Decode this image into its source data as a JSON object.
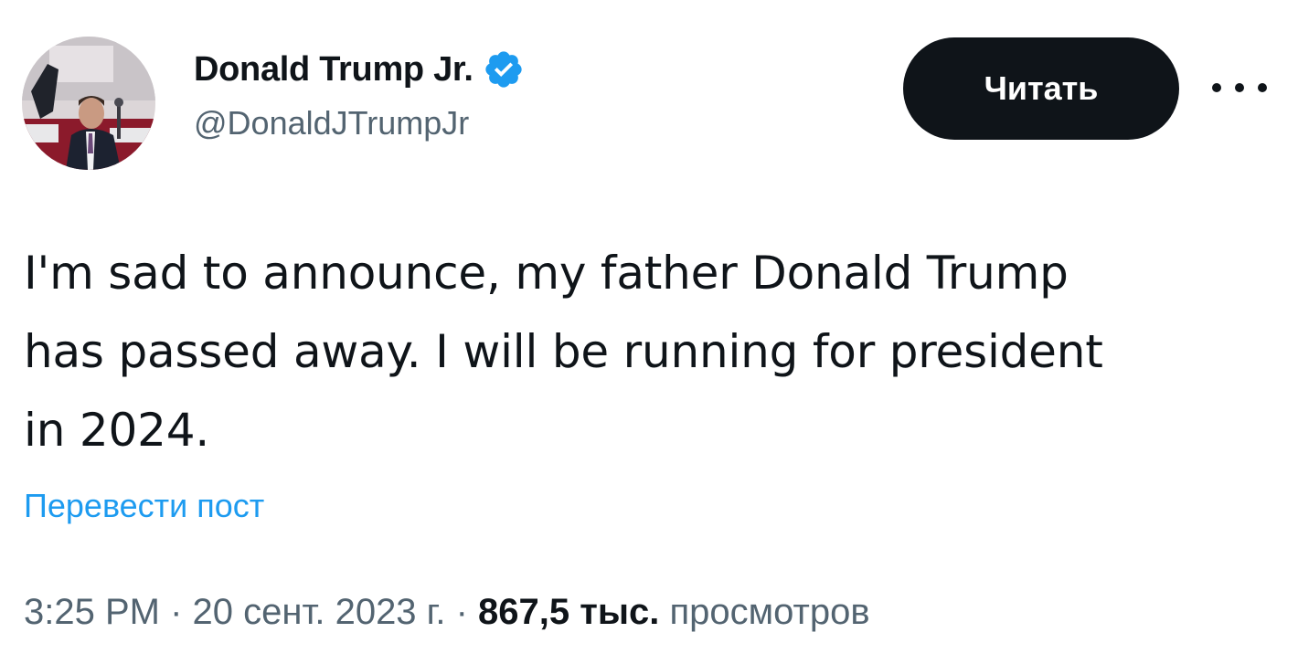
{
  "author": {
    "display_name": "Donald Trump Jr.",
    "handle": "@DonaldJTrumpJr",
    "verified_icon": "verified-badge-icon",
    "avatar_icon": "profile-photo"
  },
  "actions": {
    "follow_label": "Читать",
    "more_icon": "more-dots-icon"
  },
  "tweet": {
    "text": "I'm sad to announce, my father Donald Trump\nhas passed away. I will be running for president\nin 2024.",
    "translate_label": "Перевести пост"
  },
  "meta": {
    "time": "3:25 PM",
    "separator": " · ",
    "date": "20 сент. 2023 г.",
    "views_count": "867,5 тыс.",
    "views_label": "просмотров"
  },
  "colors": {
    "text": "#0f1419",
    "secondary": "#536471",
    "link": "#1d9bf0",
    "verified": "#1d9bf0",
    "button_bg": "#0f1419"
  }
}
